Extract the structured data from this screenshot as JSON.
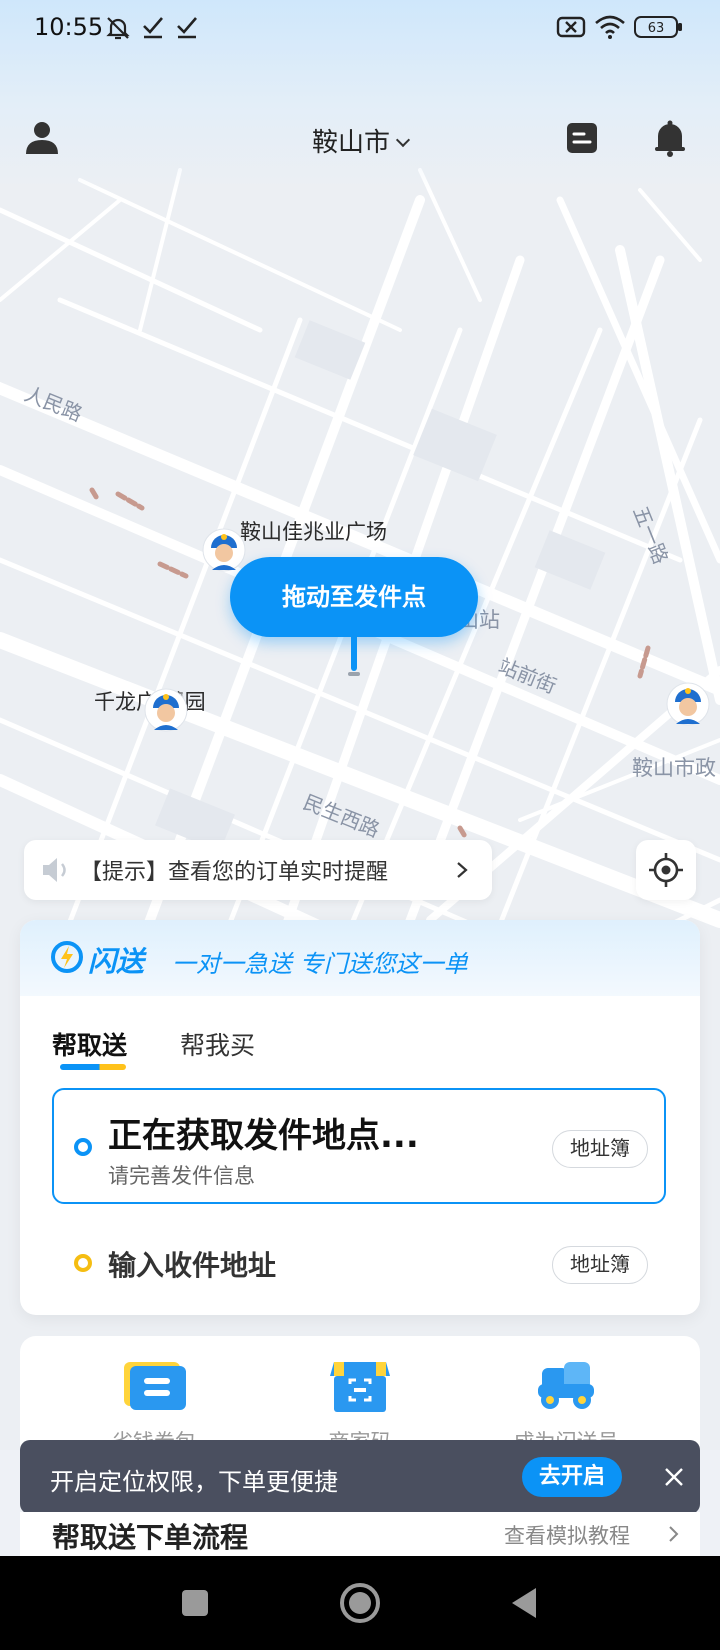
{
  "status_bar": {
    "time": "10:55",
    "battery": "63",
    "icons": [
      "bell-off-icon",
      "check-icon",
      "check-icon",
      "sim-x-icon",
      "wifi-icon",
      "battery-icon"
    ]
  },
  "header": {
    "city": "鞍山市"
  },
  "map": {
    "pois": [
      {
        "name": "鞍山佳兆业广场"
      },
      {
        "name": "千龙广      慧园"
      },
      {
        "name": "鞍山市政"
      },
      {
        "name": "山站"
      }
    ],
    "roads": [
      "人民路",
      "五一路",
      "站前街",
      "民生西路"
    ],
    "pin_label": "拖动至发件点"
  },
  "tip": {
    "text": "【提示】查看您的订单实时提醒"
  },
  "card": {
    "brand": "闪送",
    "slogan": "一对一急送 专门送您这一单",
    "tabs": [
      {
        "label": "帮取送",
        "active": true
      },
      {
        "label": "帮我买",
        "active": false
      }
    ],
    "pickup": {
      "title": "正在获取发件地点...",
      "subtitle": "请完善发件信息",
      "address_book": "地址簿"
    },
    "dropoff": {
      "title": "输入收件地址",
      "address_book": "地址簿"
    }
  },
  "services": [
    {
      "label": "省钱券包"
    },
    {
      "label": "商家码"
    },
    {
      "label": "成为闪送员"
    }
  ],
  "toast": {
    "text": "开启定位权限，下单更便捷",
    "button": "去开启"
  },
  "flow": {
    "title": "帮取送下单流程",
    "link": "查看模拟教程"
  },
  "colors": {
    "primary": "#0b93f6",
    "accent": "#f5bd12",
    "toast_bg": "#4a4f5f"
  }
}
